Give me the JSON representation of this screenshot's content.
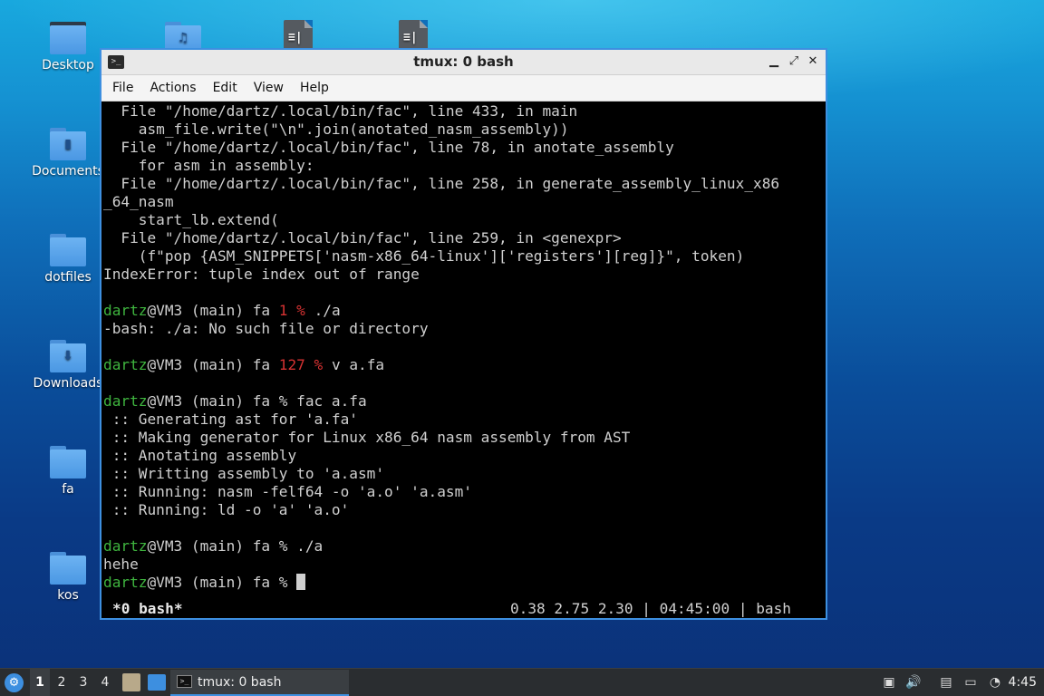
{
  "desktop": {
    "icons": [
      {
        "label": "Desktop",
        "icon": "desktop-folder-icon"
      },
      {
        "label": "Documents",
        "icon": "documents-folder-icon"
      },
      {
        "label": "dotfiles",
        "icon": "folder-icon"
      },
      {
        "label": "Downloads",
        "icon": "downloads-folder-icon"
      },
      {
        "label": "fa",
        "icon": "folder-icon"
      },
      {
        "label": "kos",
        "icon": "folder-icon"
      }
    ]
  },
  "window": {
    "title": "tmux: 0 bash",
    "menu": [
      "File",
      "Actions",
      "Edit",
      "View",
      "Help"
    ]
  },
  "terminal": {
    "lines": [
      "  File \"/home/dartz/.local/bin/fac\", line 433, in main",
      "    asm_file.write(\"\\n\".join(anotated_nasm_assembly))",
      "  File \"/home/dartz/.local/bin/fac\", line 78, in anotate_assembly",
      "    for asm in assembly:",
      "  File \"/home/dartz/.local/bin/fac\", line 258, in generate_assembly_linux_x86",
      "_64_nasm",
      "    start_lb.extend(",
      "  File \"/home/dartz/.local/bin/fac\", line 259, in <genexpr>",
      "    (f\"pop {ASM_SNIPPETS['nasm-x86_64-linux']['registers'][reg]}\", token)",
      "IndexError: tuple index out of range"
    ],
    "prompt_user": "dartz",
    "prompt_rest": "@VM3 (main) fa ",
    "cmd1_status": "1 %",
    "cmd1": " ./a",
    "out1": "-bash: ./a: No such file or directory",
    "cmd2_status": "127 %",
    "cmd2": " v a.fa",
    "cmd3": "% fac a.fa",
    "fac_output": [
      " :: Generating ast for 'a.fa'",
      " :: Making generator for Linux x86_64 nasm assembly from AST",
      " :: Anotating assembly",
      " :: Writting assembly to 'a.asm'",
      " :: Running: nasm -felf64 -o 'a.o' 'a.asm'",
      " :: Running: ld -o 'a' 'a.o'"
    ],
    "cmd4": "% ./a",
    "out4": "hehe",
    "cmd5": "% "
  },
  "tmux_status": {
    "window": "*0 bash*",
    "right": "0.38 2.75 2.30 | 04:45:00 | bash"
  },
  "taskbar": {
    "workspaces": [
      "1",
      "2",
      "3",
      "4"
    ],
    "active_task": "tmux: 0 bash",
    "clock": "4:45"
  },
  "colors": {
    "accent": "#3d8fe0",
    "prompt_user": "#3fb53f",
    "error_status": "#d63232"
  }
}
